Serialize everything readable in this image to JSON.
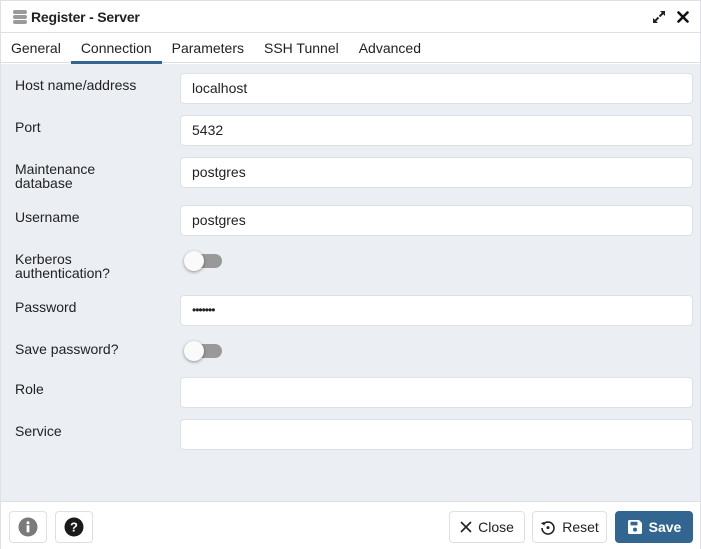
{
  "window": {
    "title": "Register - Server",
    "icons": {
      "app": "server-icon",
      "maximize": "expand-icon",
      "close": "close-icon"
    }
  },
  "tabs": [
    {
      "label": "General",
      "active": false
    },
    {
      "label": "Connection",
      "active": true
    },
    {
      "label": "Parameters",
      "active": false
    },
    {
      "label": "SSH Tunnel",
      "active": false
    },
    {
      "label": "Advanced",
      "active": false
    }
  ],
  "form": {
    "host": {
      "label": "Host name/address",
      "value": "localhost"
    },
    "port": {
      "label": "Port",
      "value": "5432"
    },
    "maintenance_db": {
      "label_line1": "Maintenance",
      "label_line2": "database",
      "value": "postgres"
    },
    "username": {
      "label": "Username",
      "value": "postgres"
    },
    "kerberos": {
      "label_line1": "Kerberos",
      "label_line2": "authentication?",
      "checked": false
    },
    "password": {
      "label": "Password",
      "value": "•••••••"
    },
    "save_password": {
      "label": "Save password?",
      "checked": false
    },
    "role": {
      "label": "Role",
      "value": ""
    },
    "service": {
      "label": "Service",
      "value": ""
    }
  },
  "footer": {
    "info_icon": "info-icon",
    "help_icon": "help-icon",
    "close_label": "Close",
    "reset_label": "Reset",
    "save_label": "Save"
  },
  "colors": {
    "accent": "#326690",
    "background": "#ebeef3"
  }
}
